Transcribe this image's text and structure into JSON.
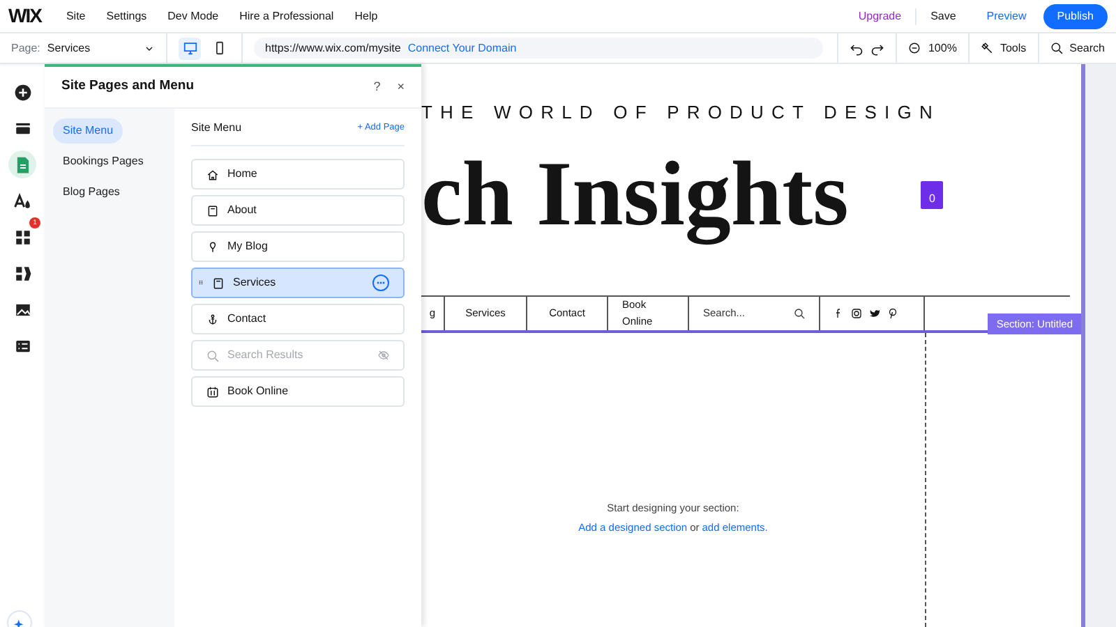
{
  "top_menu": {
    "logo": "WIX",
    "items": [
      "Site",
      "Settings",
      "Dev Mode",
      "Hire a Professional",
      "Help"
    ],
    "upgrade": "Upgrade",
    "save": "Save",
    "preview": "Preview",
    "publish": "Publish"
  },
  "toolbar": {
    "page_label": "Page:",
    "page_value": "Services",
    "devices": [
      {
        "kind": "desktop",
        "selected": true
      },
      {
        "kind": "mobile",
        "selected": false
      }
    ],
    "url": "https://www.wix.com/mysite",
    "connect": "Connect Your Domain",
    "zoom": "100%",
    "tools": "Tools",
    "search": "Search"
  },
  "left_rail": [
    {
      "kind": "add",
      "selected": false
    },
    {
      "kind": "sections",
      "selected": false
    },
    {
      "kind": "pages",
      "selected": true
    },
    {
      "kind": "design",
      "selected": false
    },
    {
      "kind": "apps",
      "selected": false,
      "badge": "1"
    },
    {
      "kind": "business",
      "selected": false
    },
    {
      "kind": "media",
      "selected": false
    },
    {
      "kind": "cms",
      "selected": false
    }
  ],
  "panel": {
    "title": "Site Pages and Menu",
    "help": "?",
    "close": "×",
    "categories": [
      {
        "label": "Site Menu",
        "selected": true
      },
      {
        "label": "Bookings Pages",
        "selected": false
      },
      {
        "label": "Blog Pages",
        "selected": false
      }
    ],
    "list_title": "Site Menu",
    "add_page": "+ Add Page",
    "pages": [
      {
        "label": "Home",
        "kind": "home",
        "selected": false,
        "hidden": false
      },
      {
        "label": "About",
        "kind": "page",
        "selected": false,
        "hidden": false
      },
      {
        "label": "My Blog",
        "kind": "blog",
        "selected": false,
        "hidden": false
      },
      {
        "label": "Services",
        "kind": "page",
        "selected": true,
        "hidden": false
      },
      {
        "label": "Contact",
        "kind": "anchor",
        "selected": false,
        "hidden": false
      },
      {
        "label": "Search Results",
        "kind": "search",
        "selected": false,
        "hidden": true
      },
      {
        "label": "Book Online",
        "kind": "booking",
        "selected": false,
        "hidden": false
      }
    ]
  },
  "site": {
    "tagline": "THE WORLD OF PRODUCT DESIGN",
    "title": "ch Insights",
    "cart_count": "0",
    "nav": [
      "g",
      "Services",
      "Contact",
      "Book Online"
    ],
    "search_placeholder": "Search...",
    "section_label": "Section: Untitled",
    "prompt": "Start designing your section:",
    "link_section": "Add a designed section",
    "link_or": "or",
    "link_elements": "add elements."
  }
}
